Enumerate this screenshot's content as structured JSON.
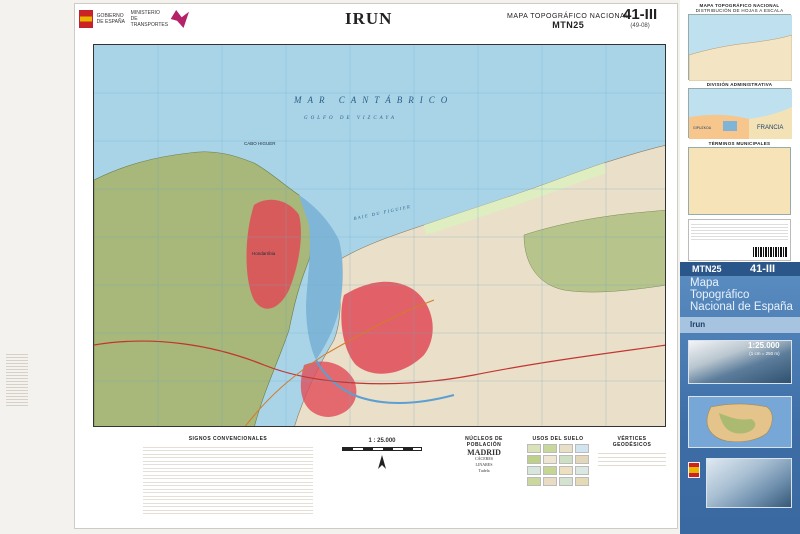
{
  "header": {
    "ministry_text": "GOBIERNO DE ESPAÑA",
    "ministry_sub": "MINISTERIO DE TRANSPORTES",
    "title": "IRUN",
    "series_name": "MAPA TOPOGRÁFICO NACIONAL",
    "series_code": "MTN25",
    "sheet_number": "41-III",
    "sheet_sub": "(49-08)"
  },
  "map": {
    "labels": {
      "sea": "MAR CANTÁBRICO",
      "gulf": "GOLFO DE VIZCAYA",
      "bay": "BAIE DU FIGUIER",
      "cape": "CABO HIGUER",
      "town": "Hondarribia"
    },
    "colors": {
      "sea": "#a9d4e8",
      "forest": "#a8b77a",
      "land": "#eadfc9",
      "urban": "#e14b57",
      "river": "#7fb6d8",
      "coast_highlight": "#dfeec1"
    }
  },
  "legend": {
    "signs_title": "SIGNOS CONVENCIONALES",
    "scale": "1 : 25.000",
    "population_title": "NÚCLEOS DE POBLACIÓN",
    "land_use_title": "USOS DEL SUELO",
    "geodesic_title": "VÉRTICES GEODÉSICOS",
    "city_names": [
      "MADRID",
      "CÁCERES",
      "LINARES",
      "Tudela"
    ]
  },
  "panel": {
    "distribution_title": "MAPA TOPOGRÁFICO NACIONAL",
    "distribution_sub": "DISTRIBUCIÓN DE HOJAS A ESCALA 1:50.000",
    "admin_title": "DIVISIÓN ADMINISTRATIVA",
    "admin_country": "FRANCIA",
    "admin_province": "GIPUZKOA",
    "municipal_title": "TÉRMINOS MUNICIPALES",
    "cover_series": "MTN25",
    "cover_sheet": "41-III",
    "cover_title_lines": [
      "Mapa",
      "Topográfico",
      "Nacional de España"
    ],
    "cover_place": "Irun",
    "cover_scale": "1:25.000",
    "cover_scale_sub": "(1 cm = 250 m)"
  }
}
